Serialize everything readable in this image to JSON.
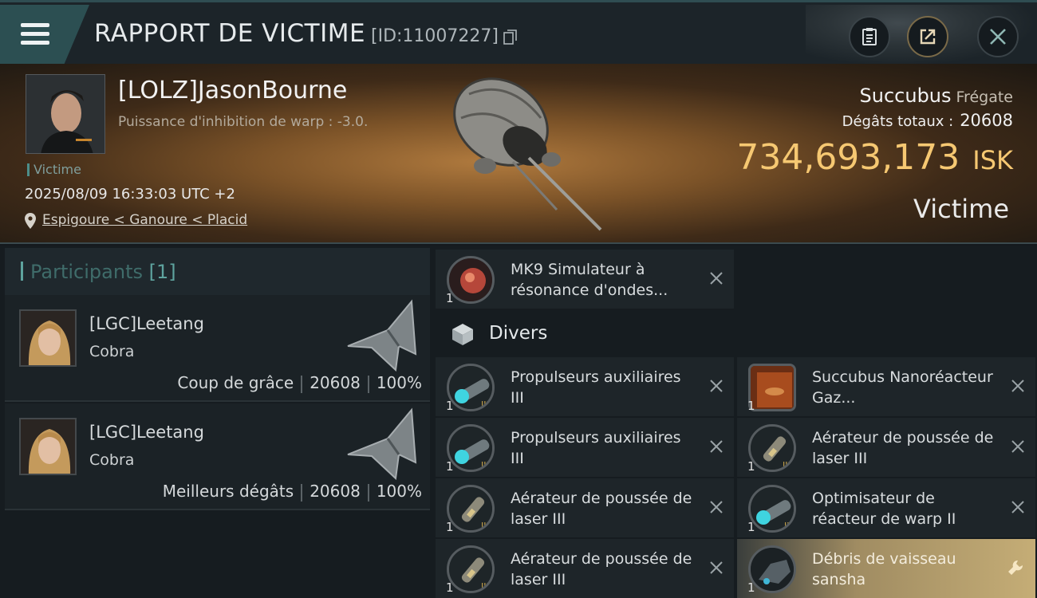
{
  "header": {
    "title": "RAPPORT DE VICTIME",
    "report_id": "[ID:11007227]",
    "icons": [
      "menu-icon",
      "copy-icon",
      "clipboard-icon",
      "share-icon",
      "close-icon"
    ]
  },
  "victim": {
    "name": "[LOLZ]JasonBourne",
    "subtitle": "Puissance d'inhibition de warp : -3.0.",
    "tag": "Victime",
    "datetime": "2025/08/09 16:33:03 UTC +2",
    "location": "Espigoure < Ganoure < Placid",
    "ship": "Succubus",
    "ship_class": "Frégate",
    "damage_label": "Dégâts totaux :",
    "damage_value": "20608",
    "isk_value": "734,693,173",
    "isk_unit": "ISK",
    "status": "Victime"
  },
  "participants": {
    "title": "Participants",
    "count": "[1]",
    "rows": [
      {
        "name": "[LGC]Leetang",
        "ship": "Cobra",
        "role": "Coup de grâce",
        "damage": "20608",
        "percent": "100%"
      },
      {
        "name": "[LGC]Leetang",
        "ship": "Cobra",
        "role": "Meilleurs dégâts",
        "damage": "20608",
        "percent": "100%"
      }
    ]
  },
  "items": {
    "top": {
      "name": "MK9 Simulateur à résonance d'ondes...",
      "qty": "1",
      "icon": "resonance-simulator-icon"
    },
    "section_label": "Divers",
    "grid": [
      {
        "name": "Propulseurs auxiliaires III",
        "qty": "1",
        "icon": "thruster-icon",
        "action": "close-icon"
      },
      {
        "name": "Succubus Nanoréacteur Gaz...",
        "qty": "1",
        "icon": "nanoreactor-icon",
        "action": "close-icon"
      },
      {
        "name": "Propulseurs auxiliaires III",
        "qty": "1",
        "icon": "thruster-icon",
        "action": "close-icon"
      },
      {
        "name": "Aérateur de poussée de laser III",
        "qty": "1",
        "icon": "laser-aerator-icon",
        "action": "close-icon"
      },
      {
        "name": "Aérateur de poussée de laser III",
        "qty": "1",
        "icon": "laser-aerator-icon",
        "action": "close-icon"
      },
      {
        "name": "Optimisateur de réacteur de warp II",
        "qty": "1",
        "icon": "warp-optimizer-icon",
        "action": "close-icon"
      },
      {
        "name": "Aérateur de poussée de laser III",
        "qty": "1",
        "icon": "laser-aerator-icon",
        "action": "close-icon"
      },
      {
        "name": "Débris de vaisseau sansha",
        "qty": "1",
        "icon": "debris-icon",
        "action": "wrench-icon"
      }
    ]
  },
  "colors": {
    "isk": "#f6c872",
    "accent": "#5ea39e",
    "loot_highlight": "#c5ad76"
  }
}
